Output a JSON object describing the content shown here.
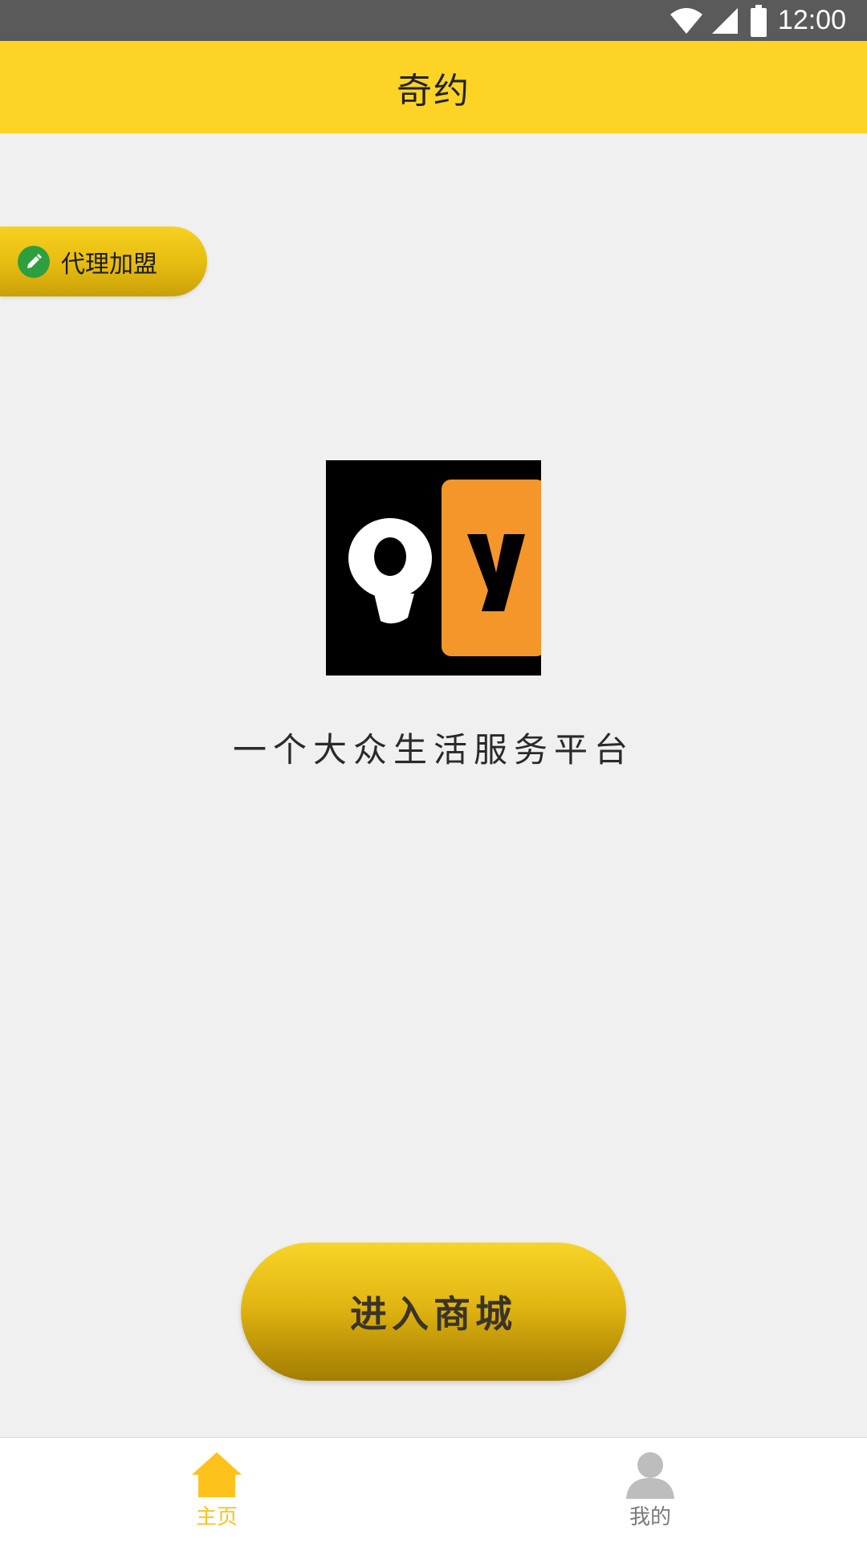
{
  "status_bar": {
    "time": "12:00",
    "icons": [
      "wifi-icon",
      "signal-icon",
      "battery-icon"
    ]
  },
  "app_bar": {
    "title": "奇约"
  },
  "agent_button": {
    "label": "代理加盟",
    "icon": "pencil-icon"
  },
  "logo": {
    "text": "Qy"
  },
  "slogan": "一个大众生活服务平台",
  "enter_button": {
    "label": "进入商城"
  },
  "bottom_nav": {
    "items": [
      {
        "label": "主页",
        "icon": "home-icon",
        "active": true
      },
      {
        "label": "我的",
        "icon": "person-icon",
        "active": false
      }
    ]
  },
  "colors": {
    "accent": "#fdd425",
    "active_nav": "#fdc21c",
    "inactive_nav": "#bdbdbd",
    "logo_orange": "#f5962a",
    "agent_icon_green": "#2e9f3e"
  }
}
